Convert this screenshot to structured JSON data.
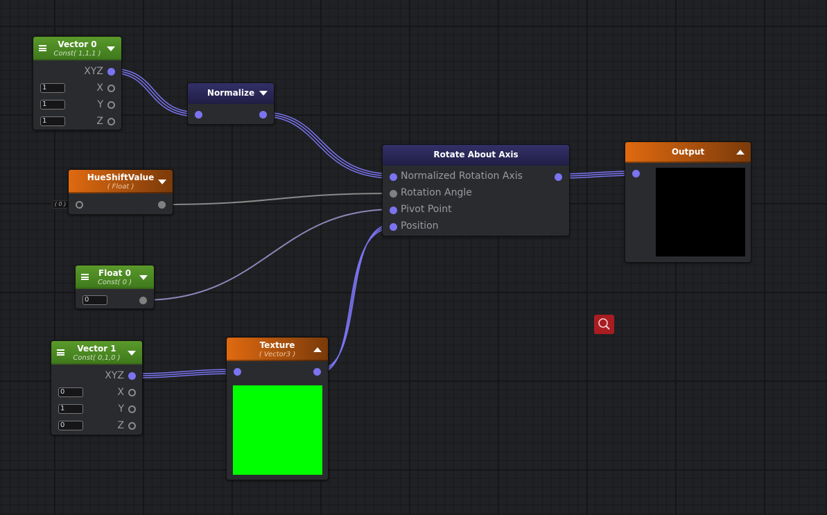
{
  "nodes": {
    "vector0": {
      "title": "Vector 0",
      "subtitle": "Const( 1,1,1 )",
      "out": "XYZ",
      "x_label": "X",
      "y_label": "Y",
      "z_label": "Z",
      "x": "1",
      "y": "1",
      "z": "1"
    },
    "normalize": {
      "title": "Normalize"
    },
    "hueshift": {
      "title": "HueShiftValue",
      "subtitle": "( Float )",
      "default": "( 0 )"
    },
    "float0": {
      "title": "Float 0",
      "subtitle": "Const( 0 )",
      "value": "0"
    },
    "vector1": {
      "title": "Vector 1",
      "subtitle": "Const( 0,1,0 )",
      "out": "XYZ",
      "x_label": "X",
      "y_label": "Y",
      "z_label": "Z",
      "x": "0",
      "y": "1",
      "z": "0"
    },
    "rotate": {
      "title": "Rotate About Axis",
      "inputs": [
        "Normalized Rotation Axis",
        "Rotation Angle",
        "Pivot Point",
        "Position"
      ]
    },
    "texture": {
      "title": "Texture",
      "subtitle": "( Vector3 )",
      "preview_color": "#00ff00"
    },
    "output": {
      "title": "Output",
      "preview_color": "#000000"
    }
  },
  "colors": {
    "vector_wire": "#7a74f0",
    "float_wire": "#8a8a8a",
    "constant_header": "#4f8a24",
    "property_header": "#d8620e",
    "function_header": "#2b2858",
    "search_button": "#a81c22"
  },
  "icons": {
    "search": "magnifier-icon",
    "menu": "hamburger-icon",
    "collapse": "triangle-icon"
  }
}
